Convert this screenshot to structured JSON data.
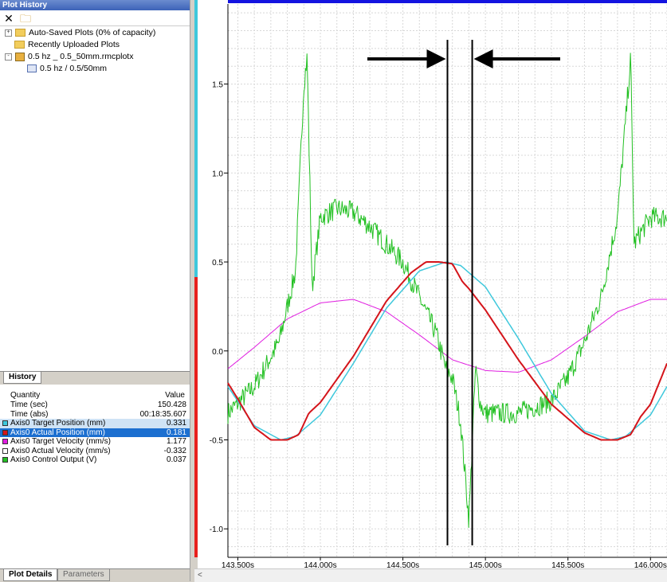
{
  "plot_history": {
    "title": "Plot History",
    "toolbar": {
      "delete_icon": "close-x-icon",
      "open_icon": "open-folder-icon"
    },
    "tree": [
      {
        "label": "Auto-Saved Plots (0% of capacity)",
        "expander": "+",
        "icon": "folder-icon"
      },
      {
        "label": "Recently Uploaded Plots",
        "expander": "",
        "icon": "folder-icon"
      },
      {
        "label": "0.5 hz _ 0.5_50mm.rmcplotx",
        "expander": "-",
        "icon": "plot-file-icon"
      },
      {
        "label": "0.5 hz / 0.5/50mm",
        "expander": "",
        "icon": "plot-icon"
      }
    ],
    "tab": "History"
  },
  "plot_details": {
    "header": {
      "quantity": "Quantity",
      "value": "Value"
    },
    "rows": [
      {
        "label": "Time (sec)",
        "value": "150.428",
        "color": ""
      },
      {
        "label": "Time (abs)",
        "value": "00:18:35.607",
        "color": ""
      },
      {
        "label": "Axis0 Target Position (mm)",
        "value": "0.331",
        "color": "#3ec8dc"
      },
      {
        "label": "Axis0 Actual Position (mm)",
        "value": "0.181",
        "color": "#d4141a"
      },
      {
        "label": "Axis0 Target Velocity (mm/s)",
        "value": "1.177",
        "color": "#e01ee0"
      },
      {
        "label": "Axis0 Actual Velocity (mm/s)",
        "value": "-0.332",
        "color": "#ffffff"
      },
      {
        "label": "Axis0 Control Output (V)",
        "value": "0.037",
        "color": "#22c022"
      }
    ],
    "tabs": {
      "active": "Plot Details",
      "inactive": "Parameters"
    }
  },
  "scroll": {
    "left_arrow": "<"
  },
  "chart_data": {
    "type": "line",
    "x_ticks": [
      "143.500s",
      "144.000s",
      "144.500s",
      "145.000s",
      "145.500s",
      "146.000s"
    ],
    "y_ticks": [
      "1.5",
      "1.0",
      "0.5",
      "0.0",
      "-0.5",
      "-1.0"
    ],
    "xlim": [
      143.44,
      146.1
    ],
    "ylim": [
      -1.16,
      1.95
    ],
    "grid": true,
    "colors": {
      "target_position": "#3ec8dc",
      "actual_position": "#d4141a",
      "target_velocity": "#e01ee0",
      "control_output": "#22c022",
      "top_bar": "#1414e0"
    },
    "series": [
      {
        "key": "target_position",
        "x": [
          143.44,
          143.6,
          143.76,
          143.85,
          144.0,
          144.2,
          144.4,
          144.6,
          144.76,
          144.85,
          145.0,
          145.2,
          145.4,
          145.6,
          145.76,
          145.85,
          146.0,
          146.1
        ],
        "y": [
          -0.2,
          -0.42,
          -0.5,
          -0.48,
          -0.36,
          -0.07,
          0.24,
          0.45,
          0.5,
          0.48,
          0.36,
          0.07,
          -0.24,
          -0.45,
          -0.5,
          -0.48,
          -0.36,
          -0.2
        ]
      },
      {
        "key": "actual_position",
        "x": [
          143.44,
          143.5,
          143.6,
          143.7,
          143.8,
          143.87,
          143.93,
          144.0,
          144.2,
          144.4,
          144.55,
          144.64,
          144.72,
          144.8,
          144.86,
          144.9,
          145.0,
          145.2,
          145.4,
          145.6,
          145.7,
          145.8,
          145.88,
          145.94,
          146.0,
          146.1
        ],
        "y": [
          -0.18,
          -0.27,
          -0.43,
          -0.5,
          -0.5,
          -0.47,
          -0.35,
          -0.29,
          -0.03,
          0.28,
          0.44,
          0.5,
          0.5,
          0.49,
          0.39,
          0.35,
          0.23,
          -0.05,
          -0.3,
          -0.46,
          -0.5,
          -0.5,
          -0.47,
          -0.37,
          -0.3,
          -0.07
        ]
      },
      {
        "key": "target_velocity",
        "x": [
          143.44,
          143.6,
          143.8,
          144.0,
          144.2,
          144.4,
          144.6,
          144.8,
          145.0,
          145.2,
          145.4,
          145.6,
          145.8,
          146.0,
          146.1
        ],
        "y": [
          -0.1,
          0.02,
          0.18,
          0.27,
          0.29,
          0.22,
          0.09,
          -0.05,
          -0.11,
          -0.12,
          -0.05,
          0.08,
          0.22,
          0.29,
          0.29
        ]
      },
      {
        "key": "control_output",
        "x": [
          143.44,
          143.6,
          143.75,
          143.85,
          143.9,
          143.92,
          143.95,
          144.0,
          144.1,
          144.2,
          144.3,
          144.4,
          144.5,
          144.6,
          144.7,
          144.76,
          144.8,
          144.85,
          144.9,
          144.94,
          144.97,
          145.0,
          145.2,
          145.4,
          145.5,
          145.6,
          145.7,
          145.8,
          145.85,
          145.88,
          145.9,
          145.93,
          146.0,
          146.1
        ],
        "y": [
          -0.35,
          -0.2,
          0.05,
          0.45,
          1.5,
          1.65,
          0.35,
          0.75,
          0.8,
          0.78,
          0.7,
          0.6,
          0.5,
          0.3,
          0.1,
          -0.1,
          -0.15,
          -0.4,
          -0.95,
          -0.1,
          -0.3,
          -0.35,
          -0.35,
          -0.28,
          -0.15,
          0.05,
          0.3,
          0.75,
          1.3,
          1.65,
          0.6,
          0.65,
          0.75,
          0.75
        ]
      }
    ],
    "markers": {
      "vlines": [
        144.77,
        144.92
      ],
      "arrows": [
        "right",
        "left"
      ]
    }
  }
}
